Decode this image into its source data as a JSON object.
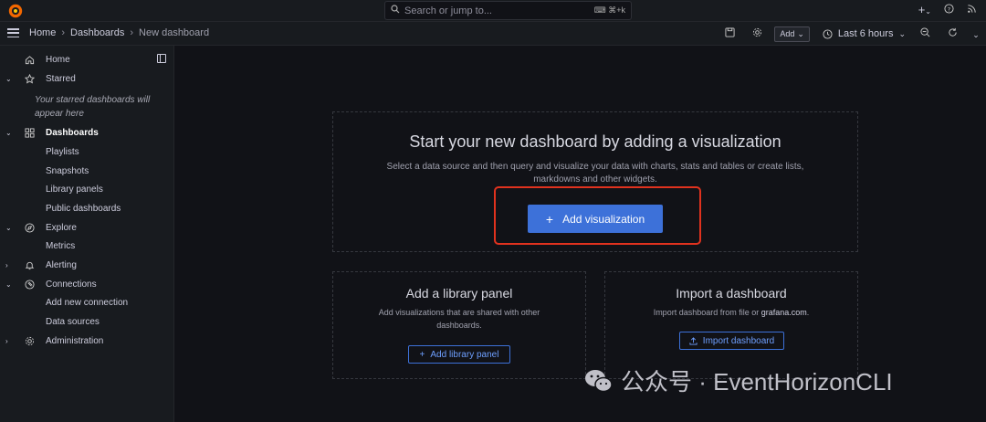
{
  "search": {
    "placeholder": "Search or jump to...",
    "shortcut": "⌘+k"
  },
  "topbar": {
    "new_icon": "plus-icon",
    "help_icon": "help-icon",
    "rss_icon": "rss-icon"
  },
  "breadcrumb": [
    "Home",
    "Dashboards",
    "New dashboard"
  ],
  "toolbar": {
    "add_label": "Add",
    "time_range": "Last 6 hours"
  },
  "sidebar": {
    "items": [
      {
        "label": "Home",
        "icon": "home-icon"
      },
      {
        "label": "Starred",
        "icon": "star-icon"
      },
      {
        "label": "Dashboards",
        "icon": "apps-icon"
      },
      {
        "label": "Playlists"
      },
      {
        "label": "Snapshots"
      },
      {
        "label": "Library panels"
      },
      {
        "label": "Public dashboards"
      },
      {
        "label": "Explore",
        "icon": "compass-icon"
      },
      {
        "label": "Metrics"
      },
      {
        "label": "Alerting",
        "icon": "bell-icon"
      },
      {
        "label": "Connections",
        "icon": "connections-icon"
      },
      {
        "label": "Add new connection"
      },
      {
        "label": "Data sources"
      },
      {
        "label": "Administration",
        "icon": "cog-icon"
      }
    ],
    "starred_note": "Your starred dashboards will appear here"
  },
  "main": {
    "hero": {
      "title": "Start your new dashboard by adding a visualization",
      "desc": "Select a data source and then query and visualize your data with charts, stats and tables or create lists, markdowns and other widgets.",
      "button": "Add visualization"
    },
    "library": {
      "title": "Add a library panel",
      "desc": "Add visualizations that are shared with other dashboards.",
      "button": "Add library panel"
    },
    "import": {
      "title": "Import a dashboard",
      "desc_pre": "Import dashboard from file or ",
      "desc_link": "grafana.com",
      "desc_post": ".",
      "button": "Import dashboard"
    }
  },
  "watermark": {
    "text": "公众号 · EventHorizonCLI"
  },
  "colors": {
    "primary": "#3d71d9",
    "highlight": "#e0321e",
    "bg": "#111217",
    "panel": "#181b1f"
  }
}
